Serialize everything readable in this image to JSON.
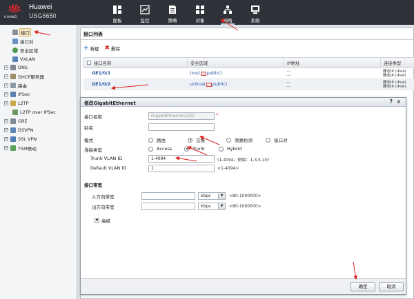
{
  "brand": {
    "name": "Huawei",
    "model": "USG6650",
    "logo_word": "HUAWEI"
  },
  "nav": [
    {
      "label": "面板",
      "icon": "dashboard-icon"
    },
    {
      "label": "监控",
      "icon": "monitor-icon"
    },
    {
      "label": "策略",
      "icon": "policy-icon"
    },
    {
      "label": "对象",
      "icon": "object-icon"
    },
    {
      "label": "网络",
      "icon": "network-icon"
    },
    {
      "label": "系统",
      "icon": "system-icon"
    }
  ],
  "sidebar": [
    {
      "label": "接口"
    },
    {
      "label": "接口对"
    },
    {
      "label": "安全区域"
    },
    {
      "label": "VXLAN"
    },
    {
      "label": "DNS"
    },
    {
      "label": "DHCP服务器"
    },
    {
      "label": "路由"
    },
    {
      "label": "IPSec"
    },
    {
      "label": "L2TP"
    },
    {
      "label": "L2TP over IPSec"
    },
    {
      "label": "GRE"
    },
    {
      "label": "DSVPN"
    },
    {
      "label": "SSL VPN"
    },
    {
      "label": "TSM联动"
    }
  ],
  "main": {
    "title": "接口列表",
    "toolbar": {
      "create": "新建",
      "delete": "删除"
    },
    "columns": [
      "接口名称",
      "安全区域",
      "IP地址",
      "连接类型"
    ],
    "rows": [
      {
        "name": "GE1/0/1",
        "zone_prefix": "trust",
        "zone_suffix": "public)",
        "ip1": "---",
        "ip2": "---",
        "conn1": "静态IP (IPv4)",
        "conn2": "静态IP (IPv6)"
      },
      {
        "name": "GE1/0/2",
        "zone_prefix": "untrust",
        "zone_suffix": "public)",
        "ip1": "---",
        "ip2": "---",
        "conn1": "静态IP (IPv4)",
        "conn2": "静态IP (IPv6)"
      }
    ]
  },
  "dialog": {
    "title": "修改GigabitEthernet",
    "help": "?",
    "close": "×",
    "iface_name_label": "接口名称",
    "iface_name_value": "GigabitEthernet1/0/2",
    "alias_label": "别名",
    "alias_value": "",
    "mode_label": "模式",
    "mode_options": [
      "路由",
      "交换",
      "旁路检测",
      "接口对"
    ],
    "conn_label": "连接类型",
    "conn_options": [
      "Access",
      "Trunk",
      "Hybrid"
    ],
    "trunk_label": "Trunk VLAN ID",
    "trunk_value": "1-4094",
    "trunk_hint": "(1-4094，例如：1,3,5-10)",
    "default_vlan_label": "Default VLAN ID",
    "default_vlan_value": "1",
    "default_vlan_hint": "<1-4094>",
    "bandwidth_section": "接口带宽",
    "in_bw_label": "入方向带宽",
    "out_bw_label": "出方向带宽",
    "bw_unit": "kbps",
    "bw_hint": "<80-1000000>",
    "advanced": "高级",
    "ok": "确定",
    "cancel": "取消"
  },
  "colors": {
    "topbar": "#2e3238",
    "link": "#1d4fa3",
    "annotation": "#e0201c"
  }
}
